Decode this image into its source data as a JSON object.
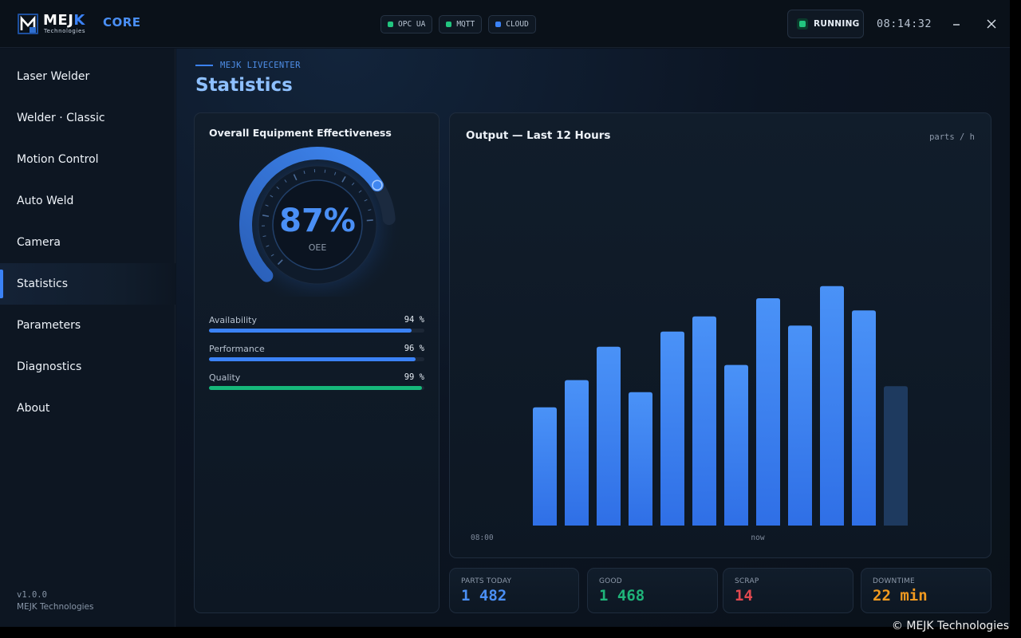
{
  "header": {
    "logo_text_main": "MEJ",
    "logo_text_accent": "K",
    "logo_subtitle": "Technologies",
    "product": "CORE",
    "chips": [
      {
        "label": "OPC UA",
        "color": "#22c57f"
      },
      {
        "label": "MQTT",
        "color": "#22c57f"
      },
      {
        "label": "CLOUD",
        "color": "#3b82f6"
      }
    ],
    "status": "RUNNING",
    "status_color": "#22c57f",
    "clock": "08:14:32",
    "minimize_icon": "minimize-icon",
    "close_icon": "close-icon"
  },
  "sidebar": {
    "items": [
      {
        "label": "Laser Welder"
      },
      {
        "label": "Welder · Classic"
      },
      {
        "label": "Motion Control"
      },
      {
        "label": "Auto Weld"
      },
      {
        "label": "Camera"
      },
      {
        "label": "Statistics",
        "active": true
      },
      {
        "label": "Parameters"
      },
      {
        "label": "Diagnostics"
      },
      {
        "label": "About"
      }
    ],
    "version": "v1.0.0",
    "company": "MEJK Technologies"
  },
  "page": {
    "eyebrow": "MEJK LIVECENTER",
    "title": "Statistics"
  },
  "oee": {
    "title": "Overall Equipment Effectiveness",
    "value_text": "87%",
    "value": 87,
    "caption": "OEE",
    "metrics": [
      {
        "label": "Availability",
        "value_text": "94 %",
        "value": 94,
        "color": "#3b82f6"
      },
      {
        "label": "Performance",
        "value_text": "96 %",
        "value": 96,
        "color": "#3b82f6"
      },
      {
        "label": "Quality",
        "value_text": "99 %",
        "value": 99,
        "color": "#16b87a"
      }
    ]
  },
  "output": {
    "title": "Output — Last 12 Hours",
    "unit": "parts / h",
    "x_start_label": "08:00",
    "x_now_label": "now"
  },
  "chart_data": {
    "type": "bar",
    "title": "Output — Last 12 Hours",
    "ylabel": "parts / h",
    "x_tick_labels": [
      "08:00",
      "now"
    ],
    "values": [
      78,
      96,
      118,
      88,
      128,
      138,
      106,
      150,
      132,
      158,
      142,
      92
    ],
    "current_hour_index": 11,
    "bar_color": "#3b82f6",
    "current_bar_color": "#1e3a5f",
    "grid": false
  },
  "kpis": [
    {
      "label": "PARTS TODAY",
      "value": "1 482",
      "color": "#4a8ff5"
    },
    {
      "label": "GOOD",
      "value": "1 468",
      "color": "#1fb57a"
    },
    {
      "label": "SCRAP",
      "value": "14",
      "color": "#e0484f"
    },
    {
      "label": "DOWNTIME",
      "value": "22 min",
      "color": "#f29a1f"
    }
  ],
  "footer": {
    "watermark": "© MEJK Technologies"
  }
}
